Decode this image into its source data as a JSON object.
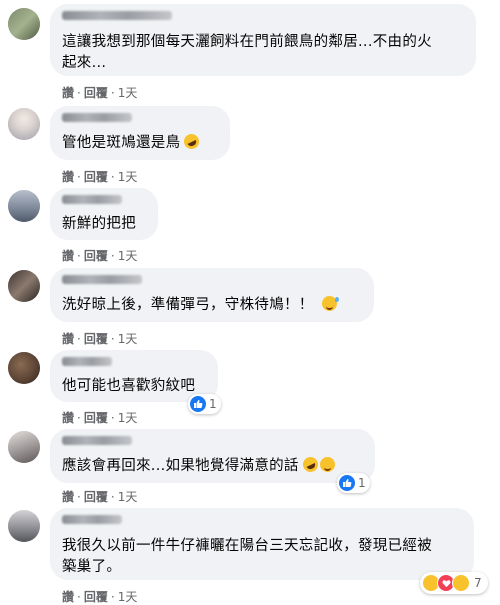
{
  "actions": {
    "like": "讚",
    "reply": "回覆",
    "separator": "·",
    "time": "1天"
  },
  "comments": [
    {
      "lines": [
        "這讓我想到那個每天灑飼料在門前餵鳥的鄰居...不由的火",
        "起來..."
      ]
    },
    {
      "lines": [
        "管他是斑鳩還是鳥"
      ],
      "emoji": "rolling-laugh-emoji"
    },
    {
      "lines": [
        "新鮮的把把"
      ]
    },
    {
      "lines": [
        "洗好晾上後，準備彈弓，守株待鳩！！"
      ],
      "emoji": "sweat-smile-emoji"
    },
    {
      "lines": [
        "他可能也喜歡豹紋吧"
      ],
      "reaction_count": "1"
    },
    {
      "lines": [
        "應該會再回來...如果牠覺得滿意的話"
      ],
      "emoji": "rolling-laugh-and-grin-emoji",
      "reaction_count": "1"
    },
    {
      "lines": [
        "我很久以前一件牛仔褲曬在陽台三天忘記收，發現已經被",
        "築巢了。"
      ],
      "reaction_count": "7",
      "reactions": [
        "haha",
        "love",
        "wow"
      ]
    }
  ],
  "colors": {
    "bubble": "#f0f2f5",
    "meta_text": "#65676b",
    "like_blue": "#1877f2",
    "text": "#050505"
  }
}
